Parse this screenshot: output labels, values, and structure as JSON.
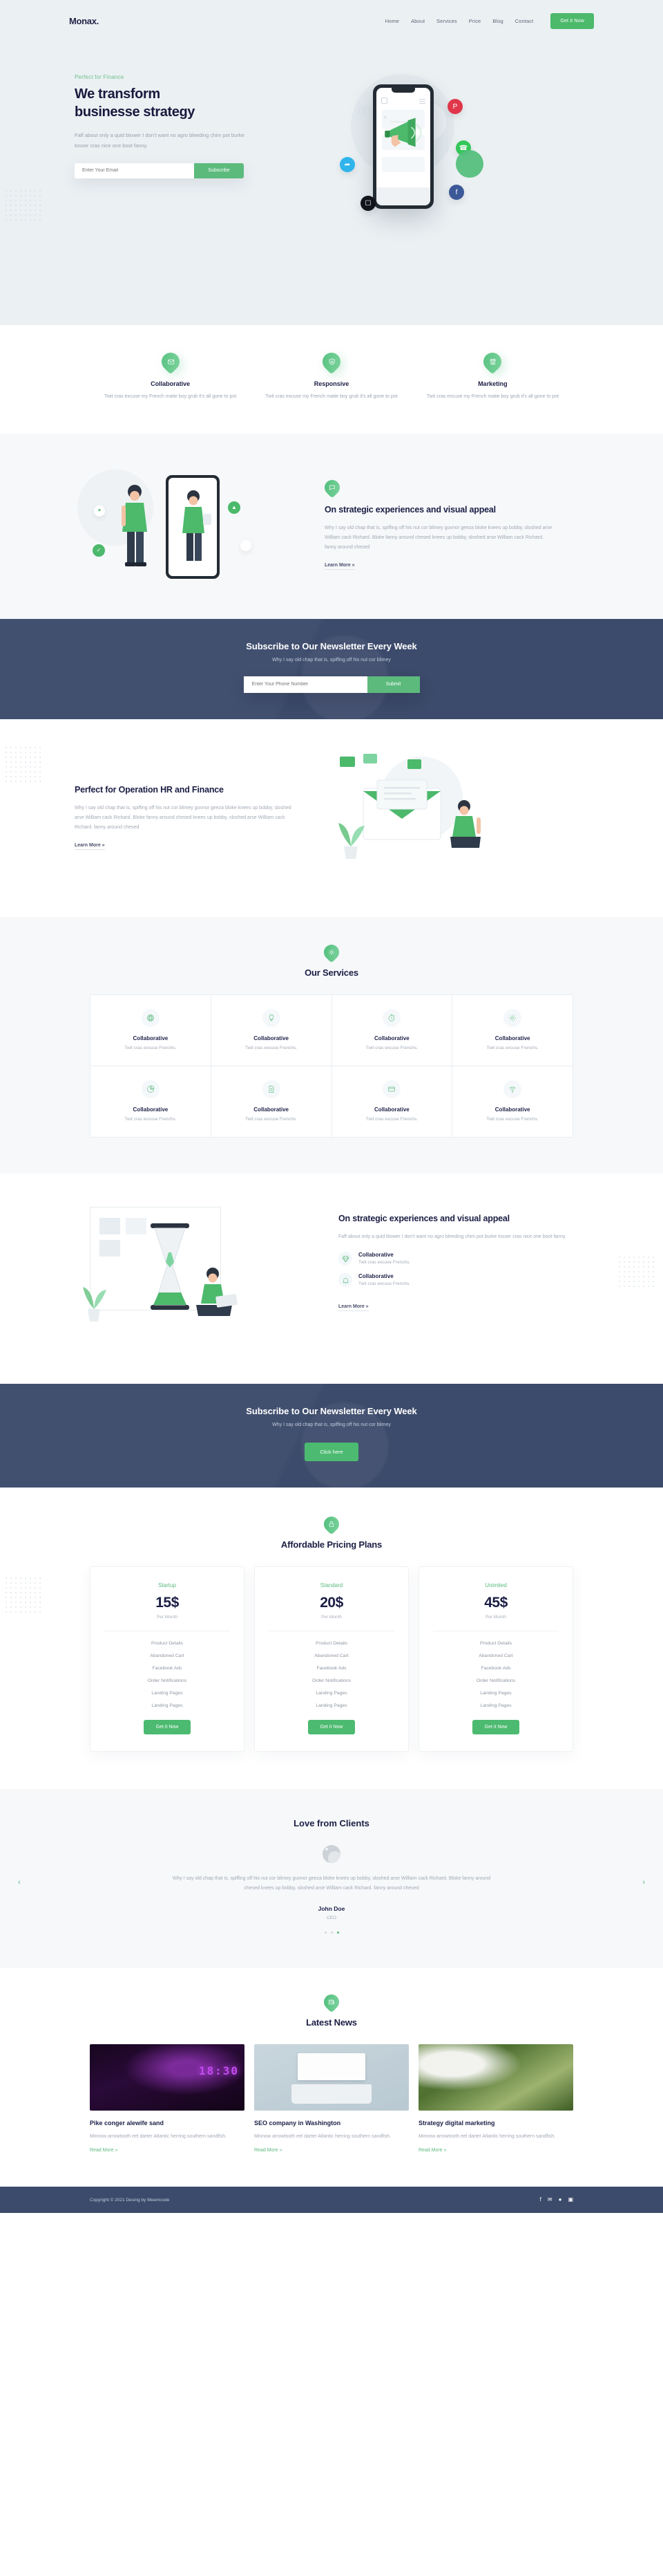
{
  "brand": {
    "logo": "Monax.",
    "accent": "#4cb96b",
    "dark": "#3c4a6b",
    "navy": "#1b1e44"
  },
  "nav": {
    "items": [
      {
        "label": "Home"
      },
      {
        "label": "About"
      },
      {
        "label": "Services"
      },
      {
        "label": "Price"
      },
      {
        "label": "Blog"
      },
      {
        "label": "Contact"
      }
    ],
    "cta": "Get it Now"
  },
  "hero": {
    "eyebrow": "Perfect for Finance",
    "title_line1": "We transform",
    "title_line2": "businesse strategy",
    "paragraph": "Faff about only a quid blower I don't want no agro bleeding chim pot burke tosser cras nice one boot fanny.",
    "input_placeholder": "Enter Your Email",
    "button": "Subscribe"
  },
  "features": [
    {
      "icon": "mail-pin-icon",
      "title": "Collaborative",
      "text": "Twit cras excuse my French matie boy grub it's all gone to pot"
    },
    {
      "icon": "shield-pin-icon",
      "title": "Responsive",
      "text": "Twit cras excuse my French matie boy grub it's all gone to pot"
    },
    {
      "icon": "store-pin-icon",
      "title": "Marketing",
      "text": "Twit cras excuse my French matie boy grub it's all gone to pot"
    }
  ],
  "strategic1": {
    "icon": "chat-pin-icon",
    "title": "On strategic experiences and visual appeal",
    "paragraph": "Why I say old chap that is, spiffing off his nut cor blimey guvnor geeza bloke knees up bobby, sloshed arse William cack Richard. Bloke fanny around chesed knees up bobby, sloshed arse William cack Richard. fanny around chesed",
    "link": "Learn More »"
  },
  "newsletter1": {
    "title": "Subscribe to Our Newsletter Every Week",
    "subtitle": "Why I say old chap that is, spiffing off his nut cor blimey",
    "input_placeholder": "Enter Your Phone Number",
    "button": "Submit"
  },
  "hrfinance": {
    "title": "Perfect for Operation HR and Finance",
    "paragraph": "Why I say old chap that is, spiffing off his nut cor blimey guvnor geeza bloke knees up bobby, sloshed arse William cack Richard. Bloke fanny around chesed knees up bobby, sloshed arse William cack Richard. fanny around chesed",
    "link": "Learn More »"
  },
  "services": {
    "icon": "gear-pin-icon",
    "title": "Our Services",
    "cards": [
      {
        "icon": "globe-icon",
        "title": "Collaborative",
        "text": "Twit cras excuse Frenchs."
      },
      {
        "icon": "bulb-icon",
        "title": "Collaborative",
        "text": "Twit cras excuse Frenchs."
      },
      {
        "icon": "stopwatch-icon",
        "title": "Collaborative",
        "text": "Twit cras excuse Frenchs."
      },
      {
        "icon": "gear-icon",
        "title": "Collaborative",
        "text": "Twit cras excuse Frenchs."
      },
      {
        "icon": "pie-chart-icon",
        "title": "Collaborative",
        "text": "Twit cras excuse Frenchs."
      },
      {
        "icon": "document-icon",
        "title": "Collaborative",
        "text": "Twit cras excuse Frenchs."
      },
      {
        "icon": "card-icon",
        "title": "Collaborative",
        "text": "Twit cras excuse Frenchs."
      },
      {
        "icon": "wifi-icon",
        "title": "Collaborative",
        "text": "Twit cras excuse Frenchs."
      }
    ]
  },
  "strategic2": {
    "title": "On strategic experiences and visual appeal",
    "paragraph": "Faff about only a quid blower I don't want no agro bleeding chim pot burke tosser cras nice one boot fanny.",
    "items": [
      {
        "icon": "diamond-icon",
        "title": "Collaborative",
        "text": "Twit cras excuse Frenchs."
      },
      {
        "icon": "bell-icon",
        "title": "Collaborative",
        "text": "Twit cras excuse Frenchs."
      }
    ],
    "link": "Learn More »"
  },
  "newsletter2": {
    "title": "Subscribe to Our Newsletter Every Week",
    "subtitle": "Why I say old chap that is, spiffing off his nut cor blimey",
    "button": "Click here"
  },
  "pricing": {
    "icon": "lock-pin-icon",
    "title": "Affordable Pricing Plans",
    "plans": [
      {
        "name": "Startup",
        "price": "15$",
        "per": "Per Month",
        "features": [
          "Product Details",
          "Abandoned Cart",
          "Facebook Ads",
          "Order Notifications",
          "Landing Pages",
          "Landing Pages"
        ],
        "button": "Get it Now"
      },
      {
        "name": "Standard",
        "price": "20$",
        "per": "Per Month",
        "features": [
          "Product Details",
          "Abandoned Cart",
          "Facebook Ads",
          "Order Notifications",
          "Landing Pages",
          "Landing Pages"
        ],
        "button": "Get it Now"
      },
      {
        "name": "Unimited",
        "price": "45$",
        "per": "Per Month",
        "features": [
          "Product Details",
          "Abandoned Cart",
          "Facebook Ads",
          "Order Notifications",
          "Landing Pages",
          "Landing Pages"
        ],
        "button": "Get it Now"
      }
    ]
  },
  "testimonial": {
    "title": "Love from Clients",
    "quote": "Why I say old chap that is, spiffing off his nut cor blimey guvnor geeza bloke knees up bobby, sloshed arse William cack Richard. Bloke fanny around chesed knees up bobby, sloshed arse William cack Richard. fanny around chesed",
    "name": "John Doe",
    "role": "CEO",
    "prev": "‹",
    "next": "›",
    "active_dot": 3,
    "dot_count": 3
  },
  "blog": {
    "icon": "news-pin-icon",
    "title": "Latest News",
    "posts": [
      {
        "image": "neon-clock-photo",
        "title": "Pike conger alewife sand",
        "excerpt": "Minnow arrowtooth eel darter Atlantic herring southern sandfish.",
        "link": "Read More »"
      },
      {
        "image": "desk-flatlay-photo",
        "title": "SEO company in Washington",
        "excerpt": "Minnow arrowtooth eel darter Atlantic herring southern sandfish.",
        "link": "Read More »"
      },
      {
        "image": "outdoor-meeting-photo",
        "title": "Strategy digital marketing",
        "excerpt": "Minnow arrowtooth eel darter Atlantic herring southern sandfish.",
        "link": "Read More »"
      }
    ]
  },
  "footer": {
    "copyright": "Copyright © 2021 Desing by Meemcode",
    "socials": [
      {
        "icon": "facebook-icon",
        "glyph": "f"
      },
      {
        "icon": "twitter-icon",
        "glyph": "✉"
      },
      {
        "icon": "dribbble-icon",
        "glyph": "●"
      },
      {
        "icon": "instagram-icon",
        "glyph": "▣"
      }
    ]
  }
}
